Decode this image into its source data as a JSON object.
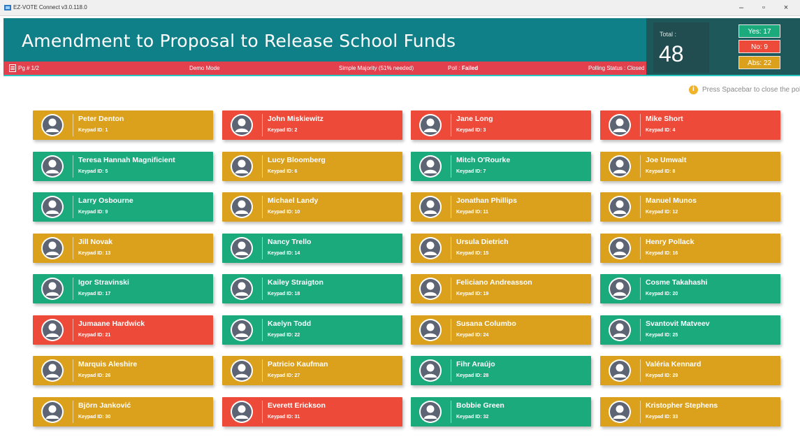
{
  "window": {
    "title": "EZ-VOTE Connect v3.0.118.0",
    "minimize": "–",
    "restore": "▫",
    "close": "×"
  },
  "header": {
    "title": "Amendment to Proposal to Release School Funds"
  },
  "status": {
    "page": "Pg # 1/2",
    "mode": "Demo Mode",
    "majority": "Simple Majority (51% needed)",
    "poll_label": "Poll : ",
    "poll_value": "Failed",
    "polling_status": "Polling Status : Closed"
  },
  "totals": {
    "label": "Total :",
    "value": "48",
    "yes": "Yes: 17",
    "no": "No: 9",
    "abs": "Abs: 22"
  },
  "hint": "Press Spacebar to close the poll",
  "colors": {
    "yes": "#1aaa7c",
    "no": "#ee4a3a",
    "abs": "#dca11c",
    "header": "#0f7f88",
    "status": "#e3404e"
  },
  "voters": [
    {
      "name": "Peter Denton",
      "keypad": "Keypad ID: 1",
      "vote": "abs"
    },
    {
      "name": "John Miskiewitz",
      "keypad": "Keypad ID: 2",
      "vote": "no"
    },
    {
      "name": "Jane Long",
      "keypad": "Keypad ID: 3",
      "vote": "no"
    },
    {
      "name": "Mike Short",
      "keypad": "Keypad ID: 4",
      "vote": "no"
    },
    {
      "name": "Teresa Hannah Magnificient",
      "keypad": "Keypad ID: 5",
      "vote": "yes"
    },
    {
      "name": "Lucy Bloomberg",
      "keypad": "Keypad ID: 6",
      "vote": "abs"
    },
    {
      "name": "Mitch O'Rourke",
      "keypad": "Keypad ID: 7",
      "vote": "yes"
    },
    {
      "name": "Joe Umwalt",
      "keypad": "Keypad ID: 8",
      "vote": "abs"
    },
    {
      "name": "Larry Osbourne",
      "keypad": "Keypad ID: 9",
      "vote": "yes"
    },
    {
      "name": "Michael Landy",
      "keypad": "Keypad ID: 10",
      "vote": "abs"
    },
    {
      "name": "Jonathan Phillips",
      "keypad": "Keypad ID: 11",
      "vote": "abs"
    },
    {
      "name": "Manuel Munos",
      "keypad": "Keypad ID: 12",
      "vote": "abs"
    },
    {
      "name": "Jill Novak",
      "keypad": "Keypad ID: 13",
      "vote": "abs"
    },
    {
      "name": "Nancy Trello",
      "keypad": "Keypad ID: 14",
      "vote": "yes"
    },
    {
      "name": "Ursula Dietrich",
      "keypad": "Keypad ID: 15",
      "vote": "abs"
    },
    {
      "name": "Henry Pollack",
      "keypad": "Keypad ID: 16",
      "vote": "abs"
    },
    {
      "name": "Igor Stravinski",
      "keypad": "Keypad ID: 17",
      "vote": "yes"
    },
    {
      "name": "Kailey Straigton",
      "keypad": "Keypad ID: 18",
      "vote": "yes"
    },
    {
      "name": "Feliciano Andreasson",
      "keypad": "Keypad ID: 19",
      "vote": "abs"
    },
    {
      "name": "Cosme Takahashi",
      "keypad": "Keypad ID: 20",
      "vote": "yes"
    },
    {
      "name": "Jumaane Hardwick",
      "keypad": "Keypad ID: 21",
      "vote": "no"
    },
    {
      "name": "Kaelyn Todd",
      "keypad": "Keypad ID: 22",
      "vote": "yes"
    },
    {
      "name": "Susana Columbo",
      "keypad": "Keypad ID: 24",
      "vote": "abs"
    },
    {
      "name": "Svantovit Matveev",
      "keypad": "Keypad ID: 25",
      "vote": "yes"
    },
    {
      "name": "Marquis Aleshire",
      "keypad": "Keypad ID: 26",
      "vote": "abs"
    },
    {
      "name": "Patricio Kaufman",
      "keypad": "Keypad ID: 27",
      "vote": "abs"
    },
    {
      "name": "Fihr Araújo",
      "keypad": "Keypad ID: 28",
      "vote": "yes"
    },
    {
      "name": "Valéria Kennard",
      "keypad": "Keypad ID: 29",
      "vote": "abs"
    },
    {
      "name": "Björn Janković",
      "keypad": "Keypad ID: 30",
      "vote": "abs"
    },
    {
      "name": "Everett Erickson",
      "keypad": "Keypad ID: 31",
      "vote": "no"
    },
    {
      "name": "Bobbie Green",
      "keypad": "Keypad ID: 32",
      "vote": "yes"
    },
    {
      "name": "Kristopher Stephens",
      "keypad": "Keypad ID: 33",
      "vote": "abs"
    }
  ]
}
